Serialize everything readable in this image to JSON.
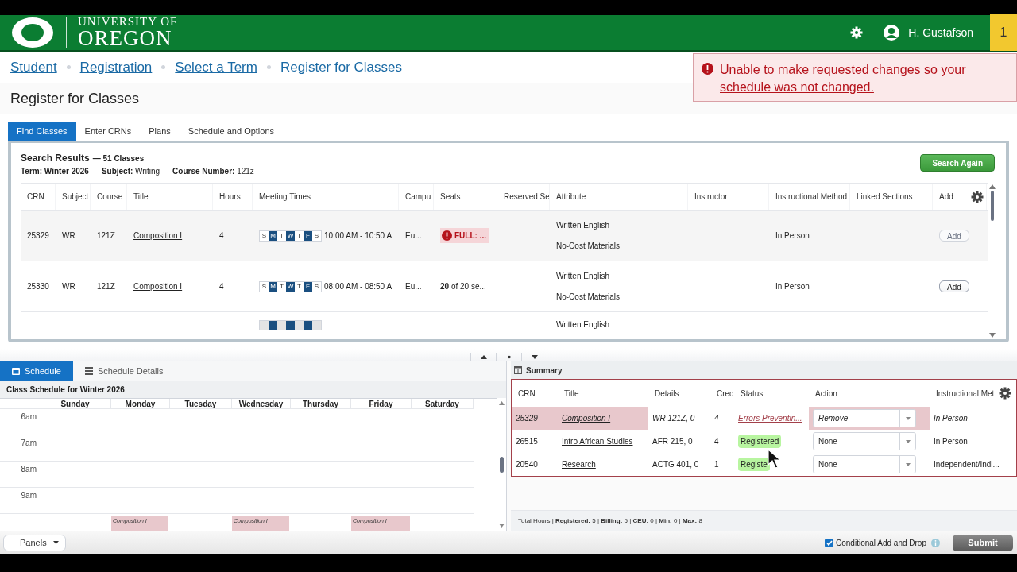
{
  "header": {
    "logo_small": "UNIVERSITY OF",
    "logo_large": "OREGON",
    "user": "H. Gustafson",
    "notification_count": "1"
  },
  "alert": {
    "message": "Unable to make requested changes so your schedule was not changed."
  },
  "breadcrumbs": [
    {
      "label": "Student",
      "link": true
    },
    {
      "label": "Registration",
      "link": true
    },
    {
      "label": "Select a Term",
      "link": true
    },
    {
      "label": "Register for Classes",
      "link": false
    }
  ],
  "page_title": "Register for Classes",
  "tabs": [
    {
      "label": "Find Classes",
      "selected": true
    },
    {
      "label": "Enter CRNs",
      "selected": false
    },
    {
      "label": "Plans",
      "selected": false
    },
    {
      "label": "Schedule and Options",
      "selected": false
    }
  ],
  "search": {
    "title": "Search Results",
    "count": "— 51 Classes",
    "filters": [
      {
        "label": "Term:",
        "value": "Winter 2026",
        "value_bold": true
      },
      {
        "label": "Subject:",
        "value": "Writing",
        "value_bold": false
      },
      {
        "label": "Course Number:",
        "value": "121z",
        "value_bold": false
      }
    ],
    "button": "Search Again",
    "columns": [
      "CRN",
      "Subject",
      "Course",
      "Title",
      "Hours",
      "Meeting Times",
      "Campu",
      "Seats",
      "Reserved Se",
      "Attribute",
      "Instructor",
      "Instructional Method",
      "Linked Sections",
      "Add"
    ],
    "rows": [
      {
        "crn": "25329",
        "subject": "WR",
        "course": "121Z",
        "title": "Composition I",
        "hours": "4",
        "days": [
          {
            "label": "S",
            "selected": false
          },
          {
            "label": "M",
            "selected": true
          },
          {
            "label": "T",
            "selected": false
          },
          {
            "label": "W",
            "selected": true
          },
          {
            "label": "T",
            "selected": false
          },
          {
            "label": "F",
            "selected": true
          },
          {
            "label": "S",
            "selected": false
          }
        ],
        "time": "10:00 AM - 10:50 A",
        "campus": "Eu...",
        "seats": {
          "text": "FULL: ...",
          "full": true
        },
        "attributes": [
          "Written English",
          "No-Cost Materials"
        ],
        "method": "In Person",
        "add": {
          "label": "Add",
          "disabled": true
        }
      },
      {
        "crn": "25330",
        "subject": "WR",
        "course": "121Z",
        "title": "Composition I",
        "hours": "4",
        "days": [
          {
            "label": "S",
            "selected": false
          },
          {
            "label": "M",
            "selected": true
          },
          {
            "label": "T",
            "selected": false
          },
          {
            "label": "W",
            "selected": true
          },
          {
            "label": "T",
            "selected": false
          },
          {
            "label": "F",
            "selected": true
          },
          {
            "label": "S",
            "selected": false
          }
        ],
        "time": "08:00 AM - 08:50 A",
        "campus": "Eu...",
        "seats": {
          "text": "**20** of 20 se...",
          "full": false
        },
        "attributes": [
          "Written English",
          "No-Cost Materials"
        ],
        "method": "In Person",
        "add": {
          "label": "Add",
          "disabled": false
        }
      },
      {
        "days": [
          {
            "selected": false
          },
          {
            "selected": true
          },
          {
            "selected": false
          },
          {
            "selected": true
          },
          {
            "selected": false
          },
          {
            "selected": true
          },
          {
            "selected": false
          }
        ],
        "attributes": [
          "Written English"
        ]
      }
    ]
  },
  "schedule_tabs": [
    {
      "label": "Schedule",
      "selected": true
    },
    {
      "label": "Schedule Details",
      "selected": false
    }
  ],
  "calendar": {
    "title": "Class Schedule for Winter 2026",
    "hours": [
      "6am",
      "7am",
      "8am",
      "9am"
    ],
    "days": [
      {
        "name": "Sunday"
      },
      {
        "name": "Monday",
        "events": [
          "Composition I"
        ]
      },
      {
        "name": "Tuesday"
      },
      {
        "name": "Wednesday",
        "events": [
          "Composition I"
        ]
      },
      {
        "name": "Thursday"
      },
      {
        "name": "Friday",
        "events": [
          "Composition I"
        ]
      },
      {
        "name": "Saturday"
      }
    ]
  },
  "summary": {
    "title": "Summary",
    "columns": [
      "CRN",
      "Title",
      "Details",
      "Cred",
      "Status",
      "Action",
      "Instructional Met"
    ],
    "rows": [
      {
        "kind": "error",
        "crn": "25329",
        "title": "Composition I",
        "details": "WR 121Z, 0",
        "credits": "4",
        "status": "Errors Preventin...",
        "action": "Remove",
        "method": "In Person"
      },
      {
        "kind": "registered",
        "crn": "26515",
        "title": "Intro African Studies",
        "details": "AFR 215, 0",
        "credits": "4",
        "status": "Registered",
        "action": "None",
        "method": "In Person"
      },
      {
        "kind": "registered",
        "crn": "20540",
        "title": "Research",
        "details": "ACTG 401, 0",
        "credits": "1",
        "status": "Registe",
        "action": "None",
        "method": "Independent/Indi..."
      }
    ],
    "totals": "Total Hours | **Registered:** 5 | **Billing:** 5 | **CEU:** 0 | **Min:** 0 | **Max:** 8"
  },
  "footer": {
    "panels": "Panels",
    "conditional": {
      "label": "Conditional Add and Drop",
      "checked": true
    },
    "submit": "Submit"
  }
}
